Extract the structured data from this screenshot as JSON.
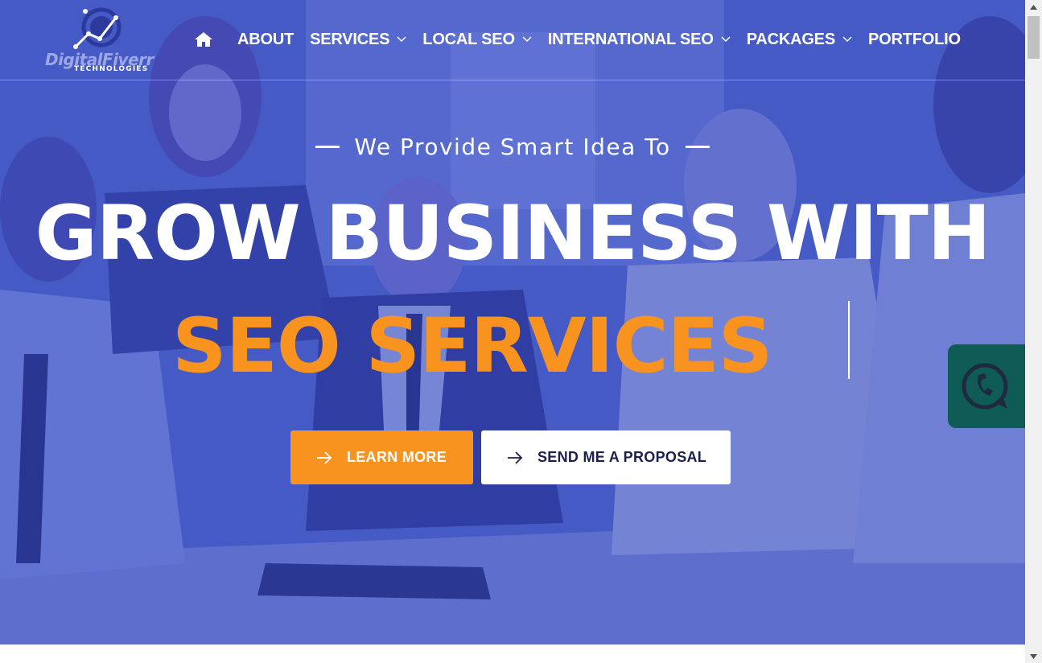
{
  "brand": {
    "name": "DigitalFiverr",
    "sub": "TECHNOLOGIES"
  },
  "nav": {
    "home_icon": "home-icon",
    "items": [
      {
        "label": "ABOUT",
        "dropdown": false
      },
      {
        "label": "SERVICES",
        "dropdown": true
      },
      {
        "label": "LOCAL SEO",
        "dropdown": true
      },
      {
        "label": "INTERNATIONAL SEO",
        "dropdown": true
      },
      {
        "label": "PACKAGES",
        "dropdown": true
      },
      {
        "label": "PORTFOLIO",
        "dropdown": false
      }
    ]
  },
  "hero": {
    "tagline": "We Provide Smart Idea To",
    "headline": "GROW BUSINESS WITH",
    "subhead": "SEO SERVICES",
    "primary_button": "LEARN MORE",
    "secondary_button": "SEND ME A PROPOSAL"
  },
  "widgets": {
    "chat_icon": "chat-icon"
  },
  "colors": {
    "overlay": "#3448be",
    "accent": "#f7931e",
    "button_text_dark": "#1b1f4d",
    "chat_widget": "#0f5c57"
  }
}
